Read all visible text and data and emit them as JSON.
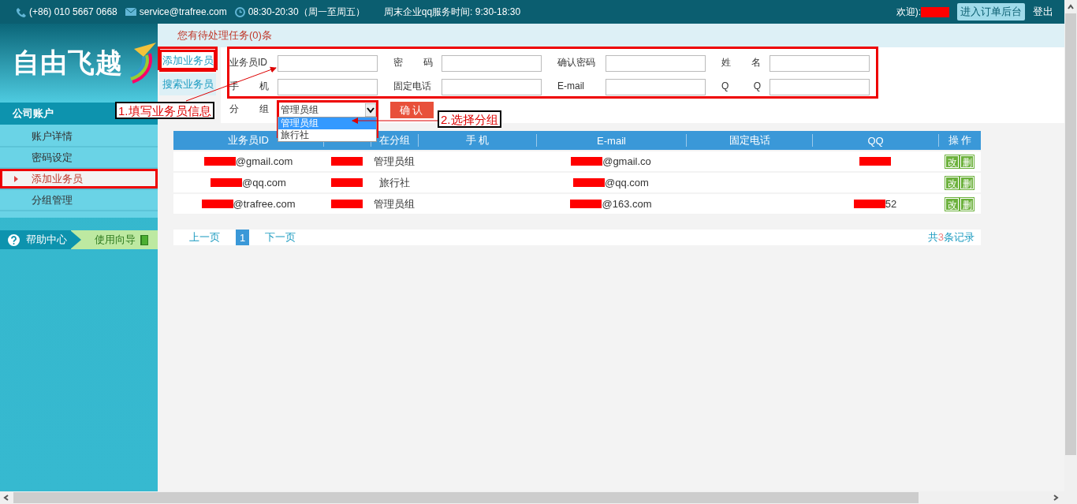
{
  "topbar": {
    "phone": "(+86) 010 5667 0668",
    "email": "service@trafree.com",
    "hours": "08:30-20:30（周一至周五）",
    "weekend": "周末企业qq服务时间: 9:30-18:30",
    "welcome": "欢迎):",
    "order_button": "进入订单后台",
    "logout": "登出"
  },
  "notice": "您有待处理任务(0)条",
  "logo": "自由飞越",
  "sidebar": {
    "section": "公司账户",
    "items": [
      {
        "label": "账户详情",
        "selected": false
      },
      {
        "label": "密码设定",
        "selected": false
      },
      {
        "label": "添加业务员",
        "selected": true
      },
      {
        "label": "分组管理",
        "selected": false
      }
    ],
    "help": "帮助中心",
    "guide": "使用向导"
  },
  "subnav": [
    {
      "label": "添加业务员",
      "selected": true
    },
    {
      "label": "搜索业务员",
      "selected": false
    }
  ],
  "form": {
    "fields": [
      {
        "label": "业务员ID",
        "spaced": false
      },
      {
        "label": "密码",
        "spaced": true
      },
      {
        "label": "确认密码",
        "spaced": false
      },
      {
        "label": "姓名",
        "spaced": true
      },
      {
        "label": "手机",
        "spaced": true
      },
      {
        "label": "固定电话",
        "spaced": false
      },
      {
        "label": "E-mail",
        "spaced": false
      },
      {
        "label": "Q Q",
        "spaced": true
      }
    ],
    "group_label": "分组",
    "group_value": "管理员组",
    "options": [
      {
        "label": "管理员组",
        "selected": true
      },
      {
        "label": "旅行社",
        "selected": false
      }
    ],
    "confirm": "确认"
  },
  "annotations": [
    {
      "text": "1.填写业务员信息"
    },
    {
      "text": "2.选择分组"
    }
  ],
  "table": {
    "columns": [
      {
        "label": "业务员ID"
      },
      {},
      {
        "label": "在分组"
      },
      {
        "label": "手 机"
      },
      {
        "label": "E-mail"
      },
      {
        "label": "固定电话"
      },
      {
        "label": "QQ"
      },
      {
        "label": "操 作"
      }
    ],
    "rows": [
      {
        "cells": [
          {
            "text": "@gmail.com",
            "redacted": true
          },
          {
            "redacted": true
          },
          {
            "text": "管理员组"
          },
          {},
          {
            "text": "@gmail.co",
            "redacted": true
          },
          {},
          {
            "redacted": true
          }
        ],
        "actions": [
          "改",
          "删"
        ]
      },
      {
        "cells": [
          {
            "text": "@qq.com",
            "redacted": true
          },
          {
            "redacted": true
          },
          {
            "text": "旅行社"
          },
          {},
          {
            "text": "@qq.com",
            "redacted": true
          },
          {},
          {}
        ],
        "actions": [
          "改",
          "删"
        ]
      },
      {
        "cells": [
          {
            "text": "@trafree.com",
            "redacted": true
          },
          {
            "redacted": true
          },
          {
            "text": "管理员组"
          },
          {},
          {
            "text": "@163.com",
            "redacted": true
          },
          {},
          {
            "text": "52",
            "redacted": true
          }
        ],
        "actions": [
          "改",
          "删"
        ]
      }
    ]
  },
  "pagination": {
    "prev": "上一页",
    "pages": [
      {
        "label": "1",
        "selected": true
      }
    ],
    "next": "下一页",
    "total_prefix": "共",
    "total_count": "3",
    "total_suffix": "条记录"
  }
}
